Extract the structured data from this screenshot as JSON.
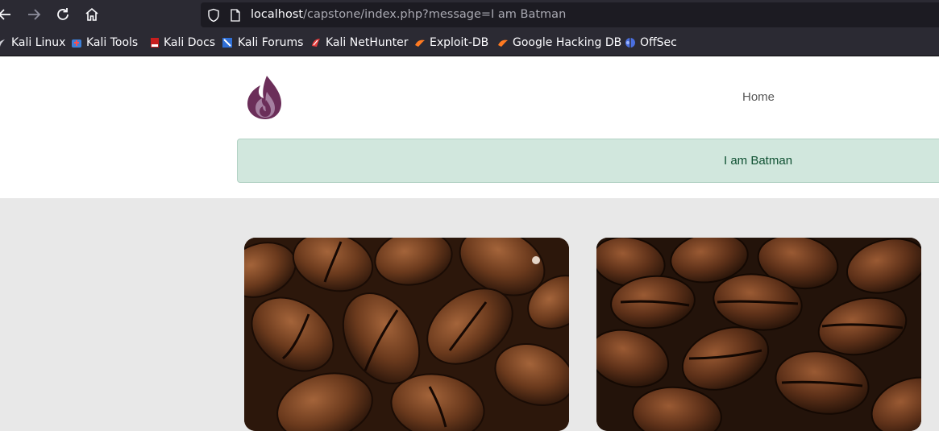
{
  "browser": {
    "url_host": "localhost",
    "url_path": "/capstone/index.php?message=I am Batman",
    "bookmarks": [
      {
        "label": "Kali Linux",
        "icon": "kali-dragon-icon"
      },
      {
        "label": "Kali Tools",
        "icon": "kali-tools-icon"
      },
      {
        "label": "Kali Docs",
        "icon": "kali-docs-icon"
      },
      {
        "label": "Kali Forums",
        "icon": "kali-forums-icon"
      },
      {
        "label": "Kali NetHunter",
        "icon": "nethunter-icon"
      },
      {
        "label": "Exploit-DB",
        "icon": "exploit-db-icon"
      },
      {
        "label": "Google Hacking DB",
        "icon": "ghdb-icon"
      },
      {
        "label": "OffSec",
        "icon": "offsec-icon"
      }
    ]
  },
  "site": {
    "logo": "flame-logo-icon",
    "nav": {
      "home": "Home"
    },
    "alert": {
      "message": "I am Batman",
      "color": "#d1e7dd",
      "text_color": "#0f5132"
    },
    "cards": [
      {
        "image": "coffee-beans-photo"
      },
      {
        "image": "coffee-beans-photo"
      }
    ]
  }
}
